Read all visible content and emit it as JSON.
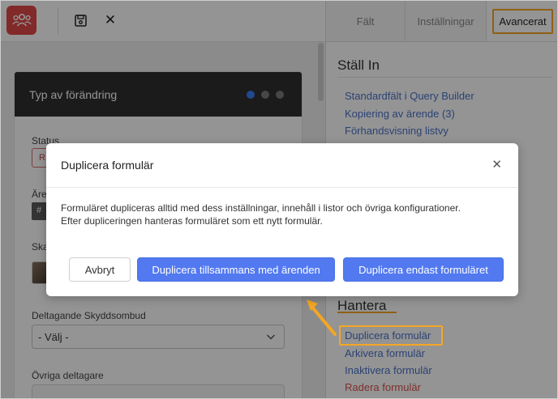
{
  "toolbar": {
    "app_icon": "people-group-icon",
    "save_icon": "save-icon",
    "close_icon": "close-icon",
    "close_glyph": "✕"
  },
  "tabs": [
    {
      "label": "Fält"
    },
    {
      "label": "Inställningar"
    },
    {
      "label": "Avancerat",
      "active": true
    }
  ],
  "form_card": {
    "title": "Typ av förändring",
    "steps": 3,
    "active_step": 1,
    "fields": {
      "status_label": "Status",
      "status_value": "R",
      "arende_label": "Äre",
      "arende_tag": "#",
      "ska_label": "Ska",
      "deltagande_label": "Deltagande Skyddsombud",
      "deltagande_value": "- Välj -",
      "ovriga_label": "Övriga deltagare"
    }
  },
  "right_panel": {
    "stall_in": {
      "title": "Ställ In",
      "links": [
        "Standardfält i Query Builder",
        "Kopiering av ärende  (3)",
        "Förhandsvisning listvy"
      ]
    },
    "hantera": {
      "title": "Hantera",
      "links": [
        {
          "label": "Duplicera formulär",
          "highlighted": true
        },
        {
          "label": "Arkivera formulär"
        },
        {
          "label": "Inaktivera formulär"
        },
        {
          "label": "Radera formulär",
          "danger": true
        }
      ]
    }
  },
  "dialog": {
    "title": "Duplicera formulär",
    "close_glyph": "✕",
    "body_line1": "Formuläret dupliceras alltid med dess inställningar, innehåll i listor och övriga konfigurationer.",
    "body_line2": "Efter dupliceringen hanteras formuläret som ett nytt formulär.",
    "cancel_label": "Avbryt",
    "primary1_label": "Duplicera tillsammans med ärenden",
    "primary2_label": "Duplicera endast formuläret"
  },
  "colors": {
    "accent": "#5279f0",
    "highlight": "#f5a623",
    "app_icon_bg": "#e04848",
    "link": "#4a72c9",
    "danger": "#d9534f"
  }
}
